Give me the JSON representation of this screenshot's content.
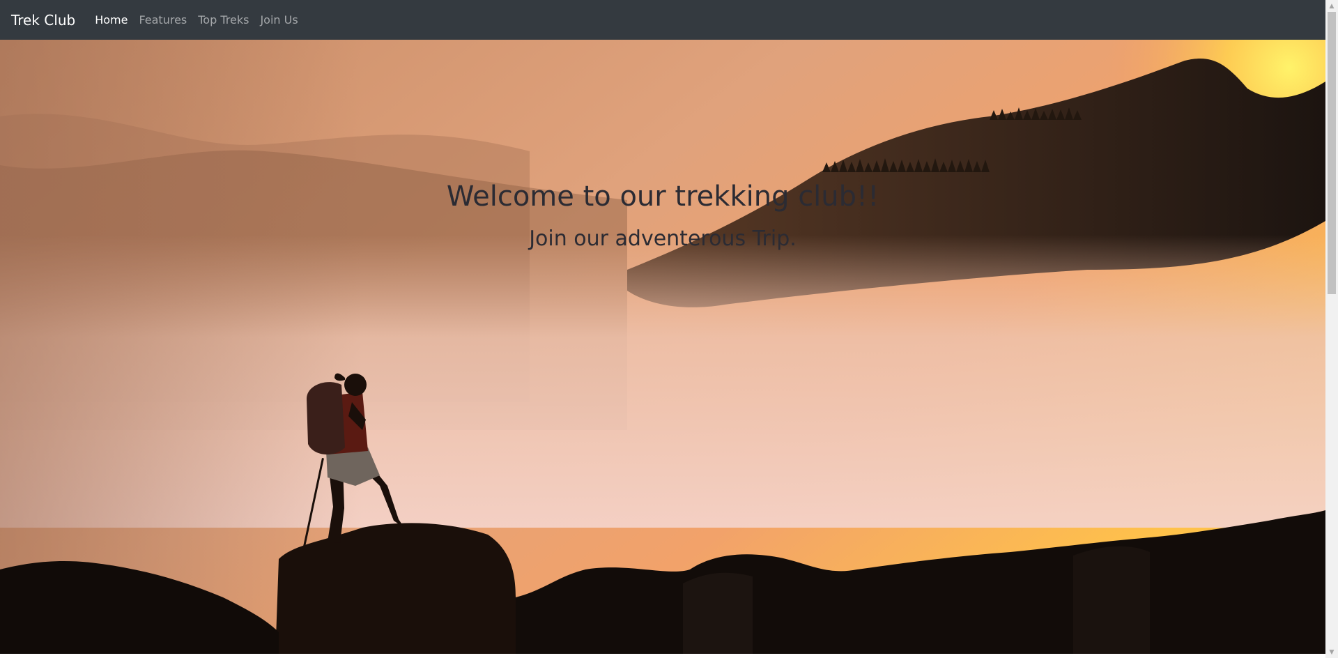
{
  "navbar": {
    "brand": "Trek Club",
    "links": [
      {
        "label": "Home",
        "active": true
      },
      {
        "label": "Features",
        "active": false
      },
      {
        "label": "Top Treks",
        "active": false
      },
      {
        "label": "Join Us",
        "active": false
      }
    ]
  },
  "hero": {
    "title": "Welcome to our trekking club!!",
    "subtitle": "Join our adventerous Trip.",
    "image": "hiker-silhouette-on-misty-mountain-at-sunset"
  },
  "colors": {
    "navbar_bg": "#343a40",
    "text_dark": "#2b2b33",
    "sky_orange": "#f0a06a",
    "sun_yellow": "#ffe35a"
  }
}
